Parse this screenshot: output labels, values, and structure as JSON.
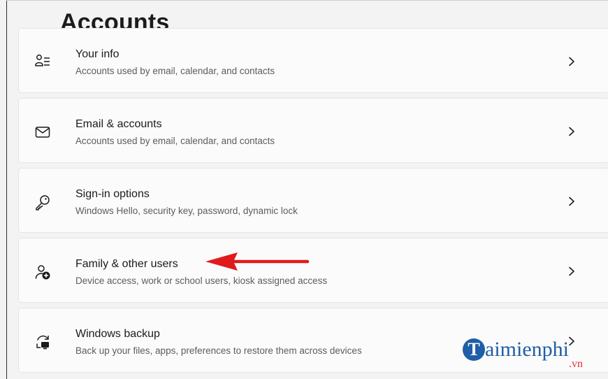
{
  "page": {
    "title": "Accounts"
  },
  "settings_items": [
    {
      "title": "Your info",
      "subtitle": "Accounts used by email, calendar, and contacts",
      "icon": "person-list-icon"
    },
    {
      "title": "Email & accounts",
      "subtitle": "Accounts used by email, calendar, and contacts",
      "icon": "mail-icon"
    },
    {
      "title": "Sign-in options",
      "subtitle": "Windows Hello, security key, password, dynamic lock",
      "icon": "key-icon"
    },
    {
      "title": "Family & other users",
      "subtitle": "Device access, work or school users, kiosk assigned access",
      "icon": "person-add-icon"
    },
    {
      "title": "Windows backup",
      "subtitle": "Back up your files, apps, preferences to restore them across devices",
      "icon": "backup-icon"
    }
  ],
  "annotation": {
    "arrow_color": "#e01b1b",
    "target_item": "Family & other users"
  },
  "watermark": {
    "letter": "T",
    "text": "aimienphi",
    "suffix": ".vn",
    "brand_color": "#1f5ea8",
    "suffix_color": "#e5322d"
  },
  "colors": {
    "background": "#f3f3f3",
    "card": "#fbfbfb",
    "card_border": "#e5e5e5",
    "title_text": "#1b1b1b",
    "subtitle_text": "#5c5c5c"
  }
}
